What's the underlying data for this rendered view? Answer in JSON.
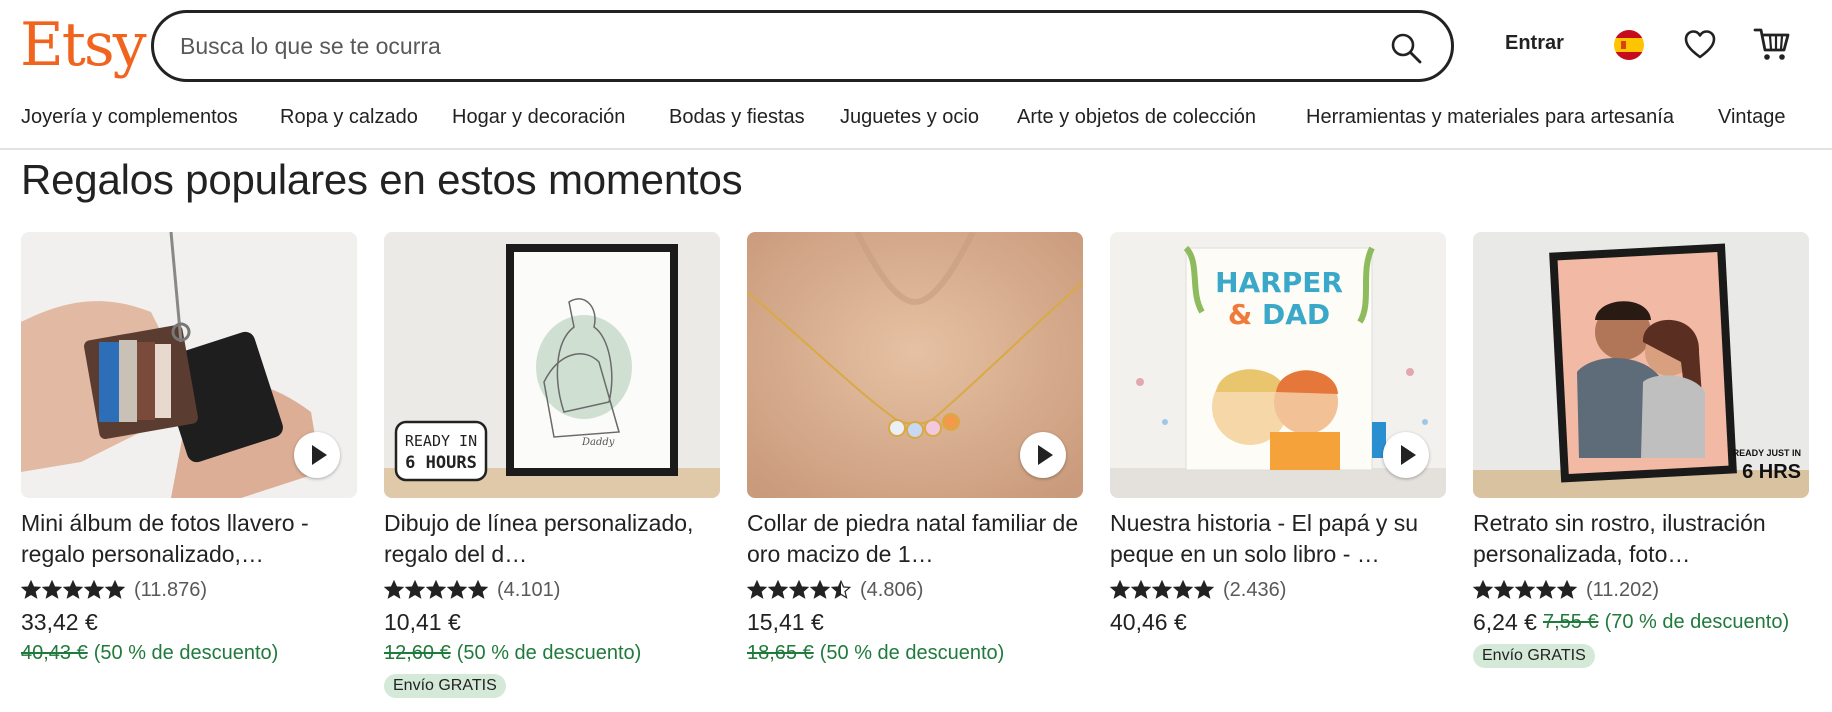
{
  "header": {
    "logo": "Etsy",
    "search_placeholder": "Busca lo que se te ocurra",
    "signin_label": "Entrar",
    "brand_color": "#F1641E"
  },
  "categories": [
    "Joyería y complementos",
    "Ropa y calzado",
    "Hogar y decoración",
    "Bodas y fiestas",
    "Juguetes y ocio",
    "Arte y objetos de colección",
    "Herramientas y materiales para artesanía",
    "Vintage"
  ],
  "section": {
    "title": "Regalos populares en estos momentos"
  },
  "products": [
    {
      "title": "Mini álbum de fotos llavero - regalo personalizado,…",
      "stars": 5,
      "reviews": "(11.876)",
      "price": "33,42 €",
      "original_price": "40,43 €",
      "discount": "(50 % de descuento)",
      "badge": "",
      "has_video": true,
      "thumb_text": ""
    },
    {
      "title": "Dibujo de línea personalizado, regalo del d…",
      "stars": 5,
      "reviews": "(4.101)",
      "price": "10,41 €",
      "original_price": "12,60 €",
      "discount": "(50 % de descuento)",
      "badge": "Envío GRATIS",
      "has_video": false,
      "thumb_text": "READY IN 6 HOURS"
    },
    {
      "title": "Collar de piedra natal familiar de oro macizo de 1…",
      "stars": 4.5,
      "reviews": "(4.806)",
      "price": "15,41 €",
      "original_price": "18,65 €",
      "discount": "(50 % de descuento)",
      "badge": "",
      "has_video": true,
      "thumb_text": ""
    },
    {
      "title": "Nuestra historia - El papá y su peque en un solo libro - …",
      "stars": 5,
      "reviews": "(2.436)",
      "price": "40,46 €",
      "original_price": "",
      "discount": "",
      "badge": "",
      "has_video": true,
      "thumb_text": "HARPER & DAD"
    },
    {
      "title": "Retrato sin rostro, ilustración personalizada, foto…",
      "stars": 5,
      "reviews": "(11.202)",
      "price": "6,24 €",
      "original_price": "7,55 €",
      "discount": "(70 % de descuento)",
      "badge": "Envío GRATIS",
      "has_video": false,
      "thumb_text": "READY JUST IN 6 HRS"
    }
  ],
  "icons": {
    "search": "search-icon",
    "flag": "spain-flag-icon",
    "favorites": "heart-icon",
    "cart": "cart-icon",
    "play": "play-icon",
    "star": "star-icon"
  },
  "colors": {
    "discount_green": "#207A3C",
    "badge_bg": "#D4E9D7"
  }
}
